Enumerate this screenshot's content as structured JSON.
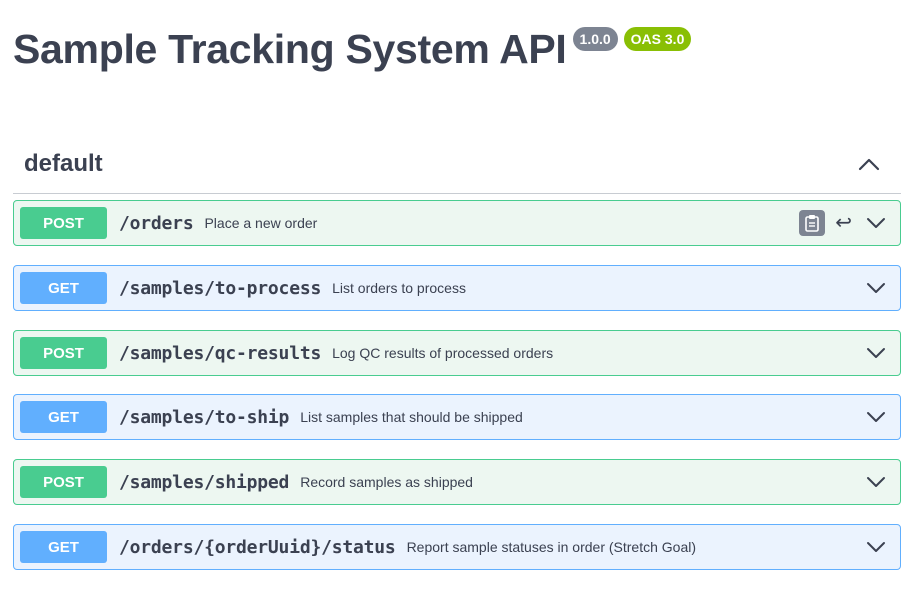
{
  "info": {
    "title": "Sample Tracking System API",
    "version_badge": "1.0.0",
    "oas_badge": "OAS 3.0"
  },
  "tag": {
    "name": "default",
    "collapse_icon": "chevron-up-icon"
  },
  "operations": [
    {
      "method": "POST",
      "path": "/orders",
      "summary": "Place a new order"
    },
    {
      "method": "GET",
      "path": "/samples/to-process",
      "summary": "List orders to process"
    },
    {
      "method": "POST",
      "path": "/samples/qc-results",
      "summary": "Log QC results of processed orders"
    },
    {
      "method": "GET",
      "path": "/samples/to-ship",
      "summary": "List samples that should be shipped"
    },
    {
      "method": "POST",
      "path": "/samples/shipped",
      "summary": "Record samples as shipped"
    },
    {
      "method": "GET",
      "path": "/orders/{orderUuid}/status",
      "summary": "Report sample statuses in order (Stretch Goal)"
    }
  ],
  "icons": {
    "copy": "clipboard-copy-icon",
    "enter": "enter-icon",
    "expand": "chevron-down-icon"
  },
  "colors": {
    "post": "#49cc90",
    "get": "#61affe",
    "version_badge": "#7d8492",
    "oas_badge": "#89bf04"
  }
}
